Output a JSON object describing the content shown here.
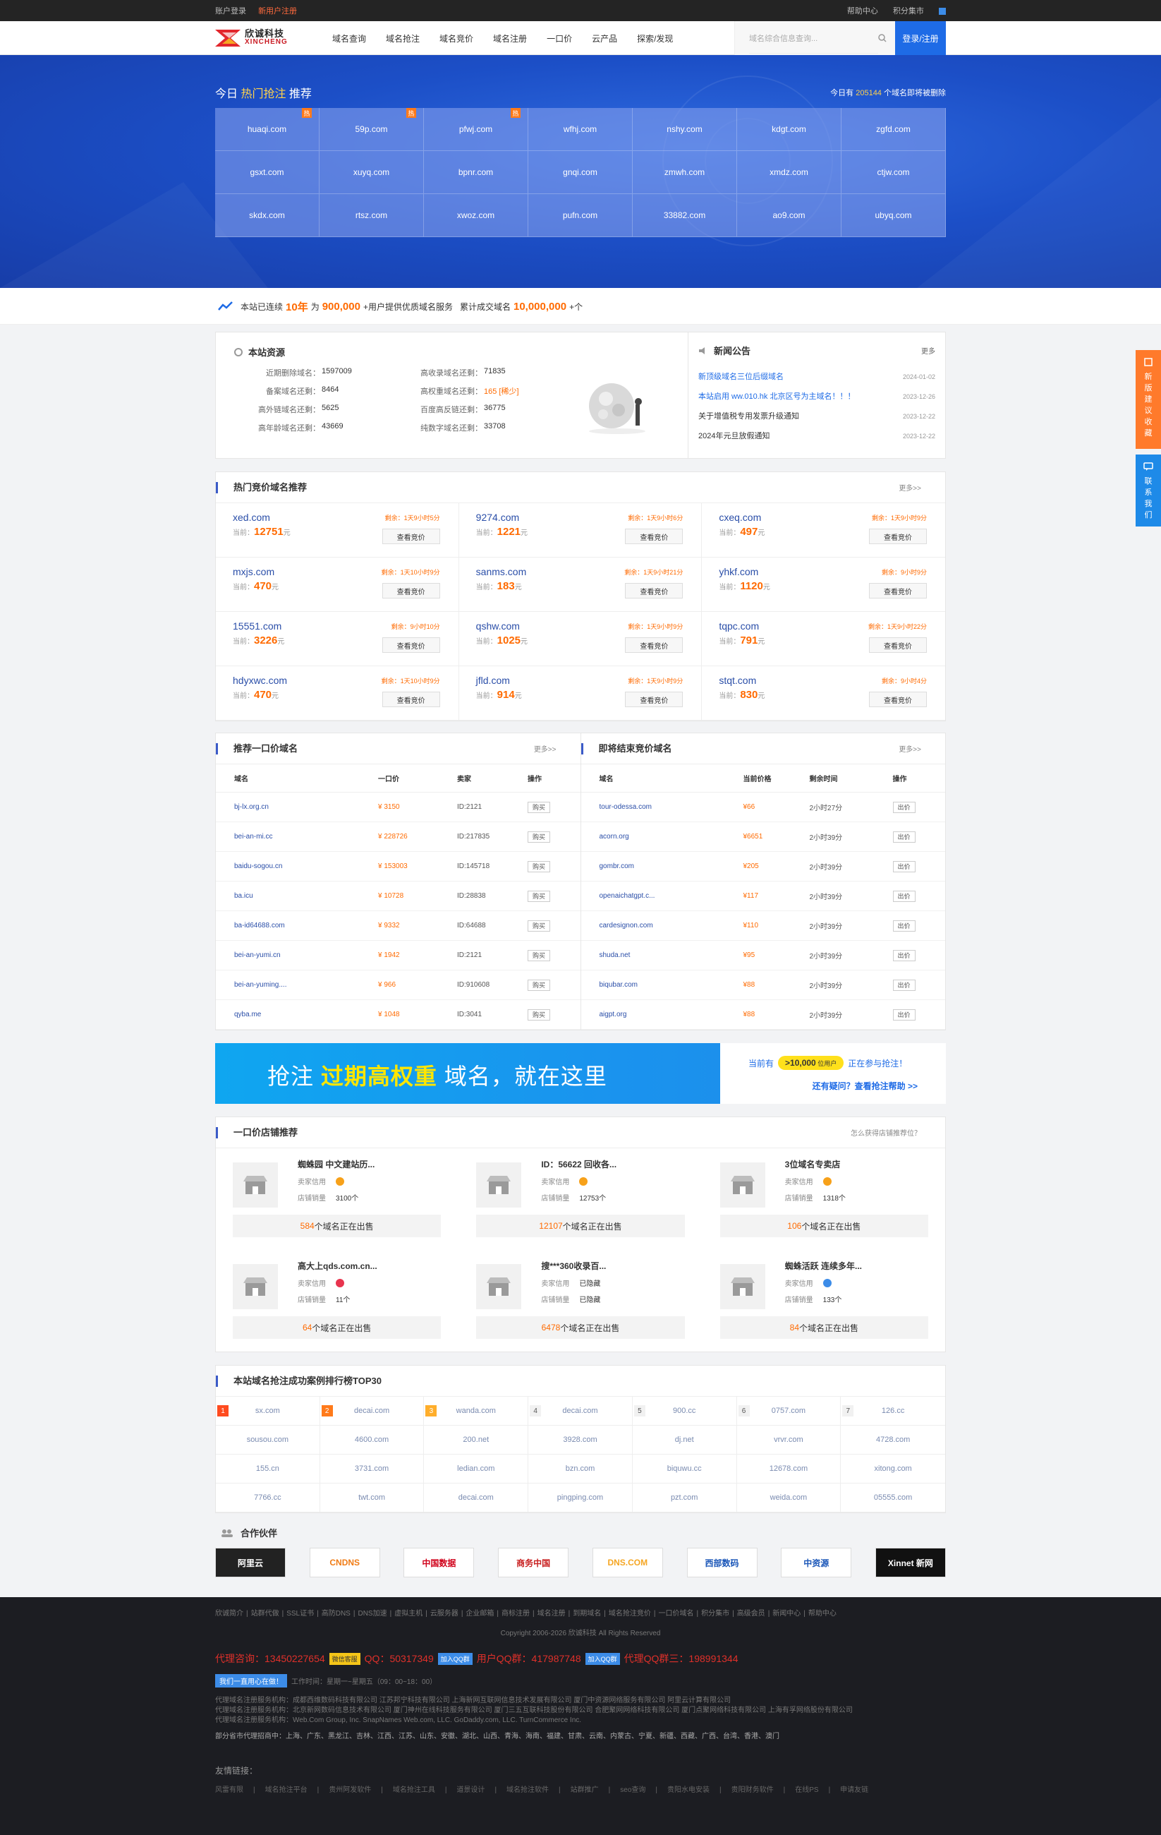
{
  "topbar": {
    "login": "账户登录",
    "register": "新用户注册",
    "help": "帮助中心",
    "points": "积分集市"
  },
  "header": {
    "logo_cn": "欣诚科技",
    "logo_en": "XINCHENG",
    "nav": [
      "域名查询",
      "域名抢注",
      "域名竞价",
      "域名注册",
      "一口价",
      "云产品",
      "探索/发现"
    ],
    "search_placeholder": "域名综合信息查询...",
    "login_btn": "登录/注册"
  },
  "banner": {
    "title_pre": "今日 ",
    "title_hl": "热门抢注",
    "title_post": " 推荐",
    "count_pre": "今日有 ",
    "count": "205144",
    "count_post": " 个域名即将被删除",
    "domains": [
      {
        "name": "huaqi.com",
        "hot": true
      },
      {
        "name": "59p.com",
        "hot": true
      },
      {
        "name": "pfwj.com",
        "hot": true
      },
      {
        "name": "wfhj.com",
        "hot": false
      },
      {
        "name": "nshy.com",
        "hot": false
      },
      {
        "name": "kdgt.com",
        "hot": false
      },
      {
        "name": "zgfd.com",
        "hot": false
      },
      {
        "name": "gsxt.com",
        "hot": false
      },
      {
        "name": "xuyq.com",
        "hot": false
      },
      {
        "name": "bpnr.com",
        "hot": false
      },
      {
        "name": "gnqi.com",
        "hot": false
      },
      {
        "name": "zmwh.com",
        "hot": false
      },
      {
        "name": "xmdz.com",
        "hot": false
      },
      {
        "name": "ctjw.com",
        "hot": false
      },
      {
        "name": "skdx.com",
        "hot": false
      },
      {
        "name": "rtsz.com",
        "hot": false
      },
      {
        "name": "xwoz.com",
        "hot": false
      },
      {
        "name": "pufn.com",
        "hot": false
      },
      {
        "name": "33882.com",
        "hot": false
      },
      {
        "name": "ao9.com",
        "hot": false
      },
      {
        "name": "ubyq.com",
        "hot": false
      }
    ],
    "hot_label": "热"
  },
  "stats": {
    "p1": "本站已连续",
    "years": "10年",
    "p2": "为",
    "users": "900,000",
    "p3": "+用户提供优质域名服务",
    "p4": "累计成交域名",
    "deals": "10,000,000",
    "p5": "+个"
  },
  "resources": {
    "title": "本站资源",
    "items": [
      {
        "k": "近期删除域名：",
        "v": "1597009"
      },
      {
        "k": "高收录域名还剩：",
        "v": "71835"
      },
      {
        "k": "备案域名还剩：",
        "v": "8464"
      },
      {
        "k": "高权重域名还剩：",
        "v": "165 [稀少]",
        "red": true
      },
      {
        "k": "高外链域名还剩：",
        "v": "5625"
      },
      {
        "k": "百度高反链还剩：",
        "v": "36775"
      },
      {
        "k": "高年龄域名还剩：",
        "v": "43669"
      },
      {
        "k": "纯数字域名还剩：",
        "v": "33708"
      }
    ]
  },
  "news": {
    "title": "新闻公告",
    "more": "更多",
    "items": [
      {
        "t": "新顶级域名三位后缀域名",
        "d": "2024-01-02",
        "blue": true
      },
      {
        "t": "本站启用 ww.010.hk 北京区号为主域名！！！",
        "d": "2023-12-26",
        "blue": true
      },
      {
        "t": "关于增值税专用发票升级通知",
        "d": "2023-12-22",
        "blue": false
      },
      {
        "t": "2024年元旦放假通知",
        "d": "2023-12-22",
        "blue": false
      }
    ]
  },
  "auction": {
    "title": "热门竞价域名推荐",
    "more": "更多>>",
    "btn": "查看竞价",
    "price_label": "当前：",
    "unit": "元",
    "items": [
      {
        "dn": "xed.com",
        "tm": "剩余：1天9小时5分",
        "p": "12751"
      },
      {
        "dn": "9274.com",
        "tm": "剩余：1天9小时6分",
        "p": "1221"
      },
      {
        "dn": "cxeq.com",
        "tm": "剩余：1天9小时9分",
        "p": "497"
      },
      {
        "dn": "mxjs.com",
        "tm": "剩余：1天10小时9分",
        "p": "470"
      },
      {
        "dn": "sanms.com",
        "tm": "剩余：1天9小时21分",
        "p": "183"
      },
      {
        "dn": "yhkf.com",
        "tm": "剩余：9小时9分",
        "p": "1120"
      },
      {
        "dn": "15551.com",
        "tm": "剩余：9小时10分",
        "p": "3226"
      },
      {
        "dn": "qshw.com",
        "tm": "剩余：1天9小时9分",
        "p": "1025"
      },
      {
        "dn": "tqpc.com",
        "tm": "剩余：1天9小时22分",
        "p": "791"
      },
      {
        "dn": "hdyxwc.com",
        "tm": "剩余：1天10小时9分",
        "p": "470"
      },
      {
        "dn": "jfld.com",
        "tm": "剩余：1天9小时9分",
        "p": "914"
      },
      {
        "dn": "stqt.com",
        "tm": "剩余：9小时4分",
        "p": "830"
      }
    ]
  },
  "fixed": {
    "title": "推荐一口价域名",
    "more": "更多>>",
    "cols": [
      "域名",
      "一口价",
      "卖家",
      "操作"
    ],
    "btn": "购买",
    "rows": [
      {
        "dn": "bj-lx.org.cn",
        "p": "¥ 3150",
        "s": "ID:2121"
      },
      {
        "dn": "bei-an-mi.cc",
        "p": "¥ 228726",
        "s": "ID:217835"
      },
      {
        "dn": "baidu-sogou.cn",
        "p": "¥ 153003",
        "s": "ID:145718"
      },
      {
        "dn": "ba.icu",
        "p": "¥ 10728",
        "s": "ID:28838"
      },
      {
        "dn": "ba-id64688.com",
        "p": "¥ 9332",
        "s": "ID:64688"
      },
      {
        "dn": "bei-an-yumi.cn",
        "p": "¥ 1942",
        "s": "ID:2121"
      },
      {
        "dn": "bei-an-yuming....",
        "p": "¥ 966",
        "s": "ID:910608"
      },
      {
        "dn": "qyba.me",
        "p": "¥ 1048",
        "s": "ID:3041"
      }
    ]
  },
  "ending": {
    "title": "即将结束竞价域名",
    "more": "更多>>",
    "cols": [
      "域名",
      "当前价格",
      "剩余时间",
      "操作"
    ],
    "btn": "出价",
    "rows": [
      {
        "dn": "tour-odessa.com",
        "p": "¥66",
        "t": "2小时27分"
      },
      {
        "dn": "acorn.org",
        "p": "¥6651",
        "t": "2小时39分"
      },
      {
        "dn": "gombr.com",
        "p": "¥205",
        "t": "2小时39分"
      },
      {
        "dn": "openaichatgpt.c...",
        "p": "¥117",
        "t": "2小时39分"
      },
      {
        "dn": "cardesignon.com",
        "p": "¥110",
        "t": "2小时39分"
      },
      {
        "dn": "shuda.net",
        "p": "¥95",
        "t": "2小时39分"
      },
      {
        "dn": "biqubar.com",
        "p": "¥88",
        "t": "2小时39分"
      },
      {
        "dn": "aigpt.org",
        "p": "¥88",
        "t": "2小时39分"
      }
    ]
  },
  "ad": {
    "p1": "抢注 ",
    "hl": "过期高权重",
    "p2": " 域名，就在这里",
    "r1a": "当前有",
    "r1b": ">10,000",
    "r1b_small": " 位用户",
    "r1c": "正在参与抢注！",
    "r2": "还有疑问？查看抢注帮助 >>"
  },
  "shops": {
    "title": "一口价店铺推荐",
    "more": "怎么获得店铺推荐位？",
    "credit": "卖家信用",
    "sales": "店铺销量",
    "on_sale": "个域名正在出售",
    "items": [
      {
        "name": "蜘蛛园 中文建站历...",
        "sales": "3100个",
        "count": "584"
      },
      {
        "name": "ID：56622 回收各...",
        "sales": "12753个",
        "count": "12107"
      },
      {
        "name": "3位域名专卖店",
        "sales": "1318个",
        "count": "106"
      },
      {
        "name": "高大上qds.com.cn...",
        "sales": "11个",
        "count": "64"
      },
      {
        "name": "搜***360收录百...",
        "sales": "已隐藏",
        "credit_text": "已隐藏",
        "count": "6478"
      },
      {
        "name": "蜘蛛活跃 连续多年...",
        "sales": "133个",
        "count": "84"
      }
    ]
  },
  "top30": {
    "title": "本站域名抢注成功案例排行榜TOP30",
    "items": [
      "sx.com",
      "decai.com",
      "wanda.com",
      "decai.com",
      "900.cc",
      "0757.com",
      "126.cc",
      "sousou.com",
      "4600.com",
      "200.net",
      "3928.com",
      "dj.net",
      "vrvr.com",
      "4728.com",
      "155.cn",
      "3731.com",
      "ledian.com",
      "bzn.com",
      "biquwu.cc",
      "12678.com",
      "xitong.com",
      "7766.cc",
      "twt.com",
      "decai.com",
      "pingping.com",
      "pzt.com",
      "weida.com",
      "05555.com"
    ]
  },
  "partners": {
    "title": "合作伙伴",
    "items": [
      "阿里云",
      "CNDNS",
      "中国数据",
      "商务中国",
      "DNS.COM",
      "西部数码",
      "中资源",
      "Xinnet 新网"
    ]
  },
  "footer": {
    "links": [
      "欣诚简介",
      "站群代做",
      "SSL证书",
      "高防DNS",
      "DNS加速",
      "虚拟主机",
      "云服务器",
      "企业邮箱",
      "商标注册",
      "域名注册",
      "到期域名",
      "域名抢注竞价",
      "一口价域名",
      "积分集市",
      "高级会员",
      "新闻中心",
      "帮助中心"
    ],
    "copyright": "Copyright 2006-2026 欣诚科技 All Rights Reserved",
    "qq_label": "代理咨询：13450227654",
    "qq_btn": "微信客服",
    "qq2": "QQ：50317349",
    "qq_btn2": "加入QQ群",
    "qq3": "用户QQ群：417987748",
    "qq_btn3": "加入QQ群",
    "qq4": "代理QQ群三：198991344",
    "work_btn": "我们一直用心在做！",
    "work": "工作时间：星期一~星期五（09：00~18：00）",
    "agent1": "代理域名注册服务机构：成都西维数码科技有限公司 江苏邦宁科技有限公司 上海新网互联网信息技术发展有限公司 厦门中资源网络服务有限公司 阿里云计算有限公司",
    "agent2": "代理域名注册服务机构：北京新网数码信息技术有限公司 厦门神州在线科技服务有限公司 厦门三五互联科技股份有限公司 合肥聚网网络科技有限公司 厦门点聚网络科技有限公司 上海有孚网络股份有限公司",
    "agent3": "代理域名注册服务机构：Web.Com Group, Inc. SnapNames Web.com, LLC. GoDaddy.com, LLC. TurnCommerce Inc.",
    "area_label": "部分省市代理招商中：",
    "area": "上海、广东、黑龙江、吉林、江西、江苏、山东、安徽、湖北、山西、青海、海南、福建、甘肃、云南、内蒙古、宁夏、新疆、西藏、广西、台湾、香港、澳门",
    "friend_title": "友情链接：",
    "friends": [
      "风雷有限",
      "域名抢注平台",
      "贵州阿发软件",
      "域名抢注工具",
      "道景设计",
      "域名抢注软件",
      "站群推广",
      "seo查询",
      "贵阳水电安装",
      "贵阳财务软件",
      "在线PS",
      "申请友链"
    ]
  },
  "side": {
    "s1": "新版建议收藏",
    "s2": "联系我们"
  },
  "colors": {
    "primary": "#1e6be6",
    "accent": "#ff6a00",
    "banner": "#1c4fc7"
  }
}
